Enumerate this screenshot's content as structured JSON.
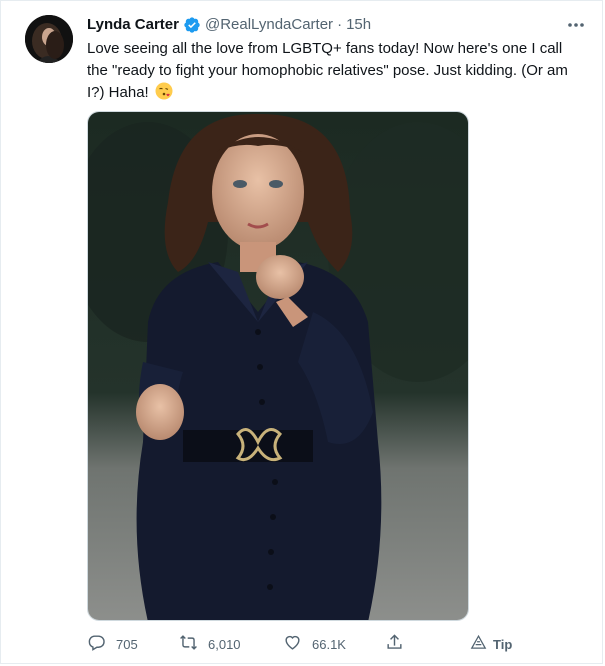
{
  "tweet": {
    "author_name": "Lynda Carter",
    "handle": "@RealLyndaCarter",
    "separator": "·",
    "time": "15h",
    "text": "Love seeing all the love from LGBTQ+ fans today! Now here's one I call the \"ready to fight your homophobic relatives\" pose. Just kidding. (Or am I?) Haha!",
    "emoji": "face-blowing-kiss"
  },
  "actions": {
    "replies": "705",
    "retweets": "6,010",
    "likes": "66.1K",
    "tip_label": "Tip"
  },
  "icons": {
    "verified": "verified-badge-icon",
    "more": "more-options-icon",
    "reply": "reply-icon",
    "retweet": "retweet-icon",
    "like": "heart-icon",
    "share": "share-icon",
    "tip": "tip-icon"
  },
  "colors": {
    "verified_blue": "#1d9bf0",
    "text_primary": "#0f1419",
    "text_secondary": "#536471",
    "border": "#cfd9de"
  }
}
